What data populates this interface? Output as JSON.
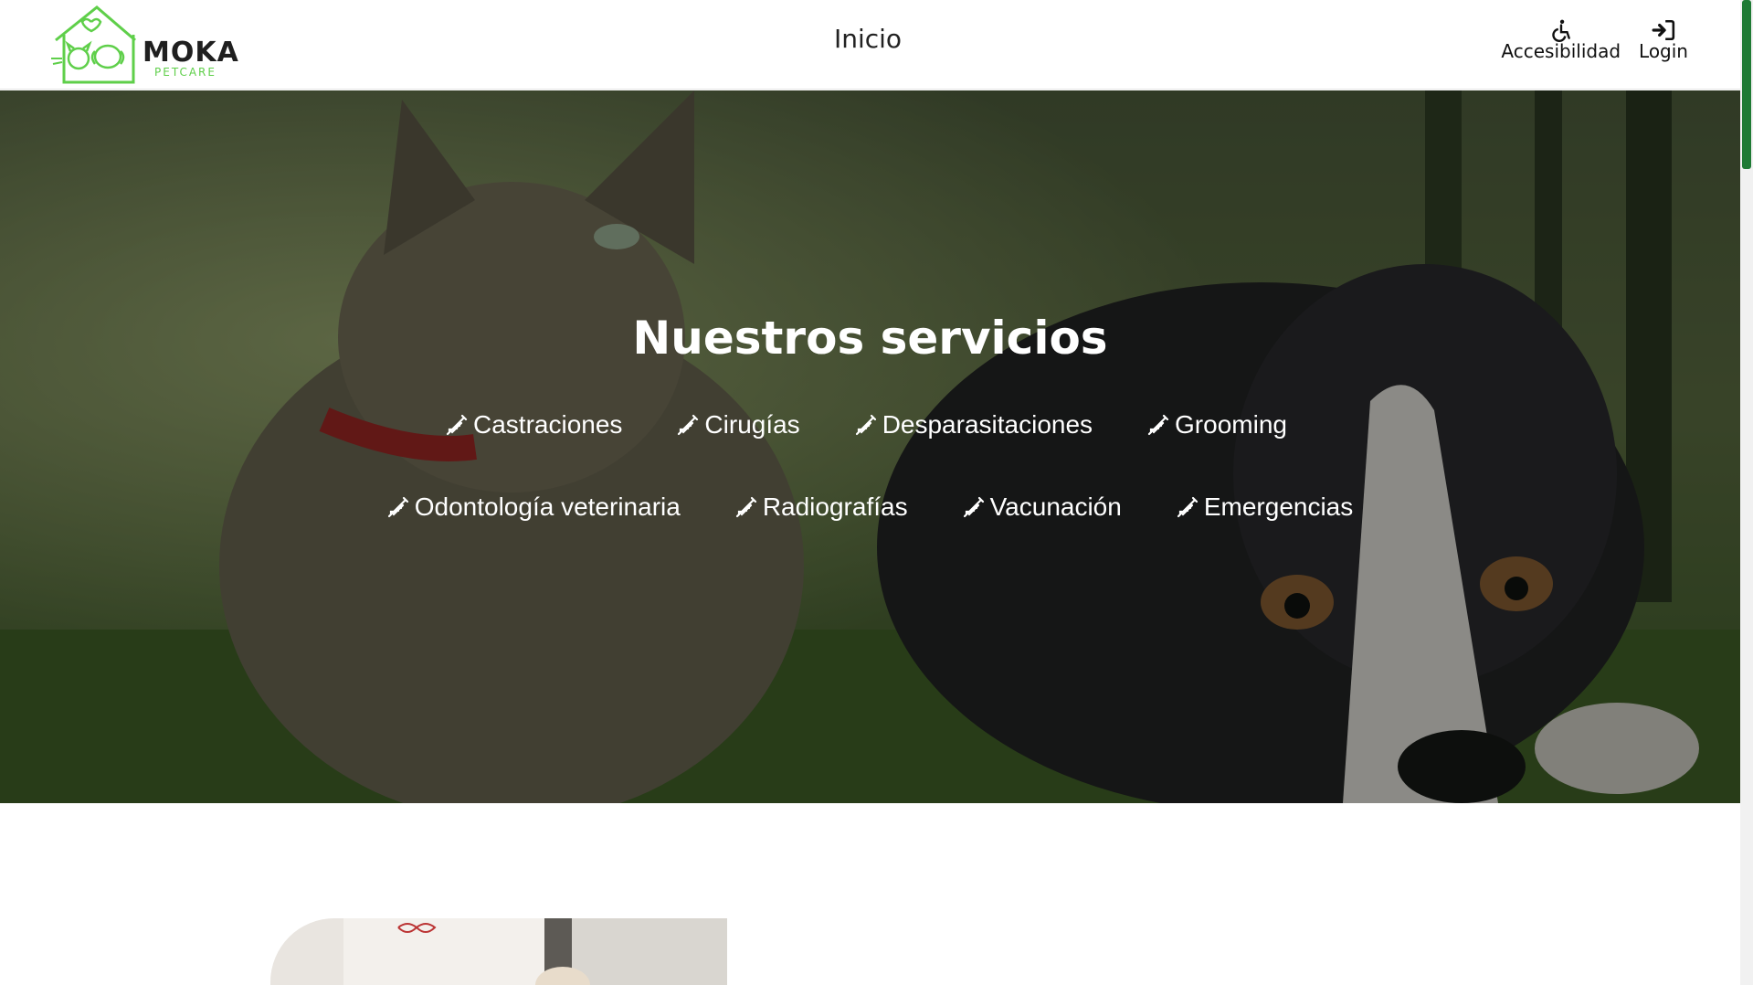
{
  "header": {
    "logo": {
      "word": "MOKA",
      "sub": "PETCARE"
    },
    "center_link": "Inicio",
    "right_items": [
      {
        "icon": "wheelchair-icon",
        "label": "Accesibilidad"
      },
      {
        "icon": "login-icon",
        "label": "Login"
      }
    ]
  },
  "hero": {
    "title": "Nuestros servicios",
    "service_icon": "syringe-icon",
    "services_row1": [
      "Castraciones",
      "Cirugías",
      "Desparasitaciones",
      "Grooming"
    ],
    "services_row2": [
      "Odontología veterinaria",
      "Radiografías",
      "Vacunación",
      "Emergencias"
    ]
  },
  "colors": {
    "brand_green": "#5fcf4a",
    "scrollbar_thumb": "#1e7a34"
  }
}
